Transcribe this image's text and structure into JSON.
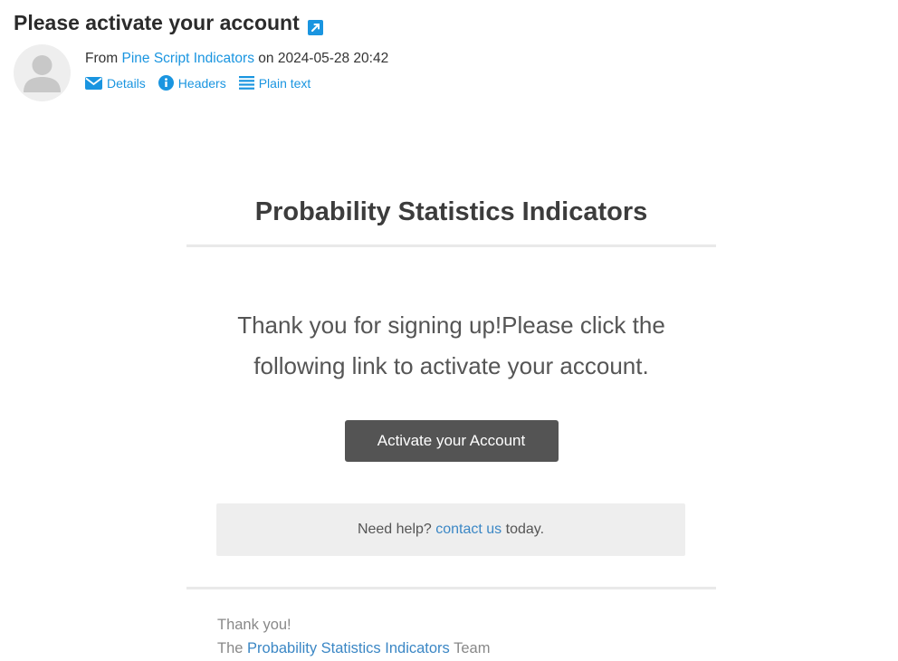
{
  "header": {
    "subject": "Please activate your account",
    "from_prefix": "From",
    "sender": "Pine Script Indicators",
    "on_text": "on",
    "date": "2024-05-28 20:42",
    "actions": {
      "details": "Details",
      "headers": "Headers",
      "plain_text": "Plain text"
    },
    "accent_color": "#1a95e0"
  },
  "email": {
    "brand": "Probability Statistics Indicators",
    "message_line1": "Thank you for signing up!Please click the",
    "message_line2": "following link to activate your account.",
    "button_label": "Activate your Account",
    "help_prefix": "Need help?",
    "help_link": "contact us",
    "help_suffix": "today.",
    "thanks": "Thank you!",
    "team_prefix": "The",
    "team_name": "Probability Statistics Indicators",
    "team_suffix": "Team",
    "button_color": "#545454",
    "link_color": "#3b87c5"
  }
}
